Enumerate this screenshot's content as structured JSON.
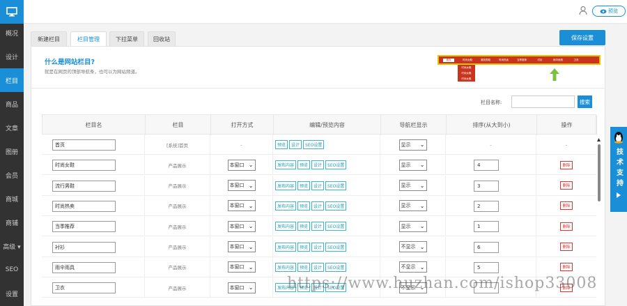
{
  "sidebar": {
    "items": [
      {
        "label": "概况"
      },
      {
        "label": "设计"
      },
      {
        "label": "栏目"
      },
      {
        "label": "商品"
      },
      {
        "label": "文章"
      },
      {
        "label": "图册"
      },
      {
        "label": "会员"
      },
      {
        "label": "商城"
      },
      {
        "label": "商铺"
      },
      {
        "label": "高级 ▾"
      },
      {
        "label": "SEO"
      },
      {
        "label": "设置"
      }
    ]
  },
  "header": {
    "preview_label": "预览"
  },
  "tabs": [
    "新建栏目",
    "栏目管理",
    "下拉菜单",
    "回收站"
  ],
  "toolbar": {
    "save_label": "保存设置"
  },
  "info": {
    "title": "什么是网站栏目?",
    "desc": "就是在网页的顶部导航条，也可以为网站频道。"
  },
  "nav_demo": {
    "items": [
      "首页",
      "时尚女鞋",
      "潮流男鞋",
      "时尚热卖",
      "当季推荐",
      "衬衫",
      "雨伞雨具",
      "卫衣"
    ],
    "submenu": [
      "时尚女鞋",
      "时尚女鞋",
      "时尚女鞋"
    ]
  },
  "filter": {
    "label": "栏目名称:",
    "button": "搜索"
  },
  "table": {
    "headers": [
      "栏目名",
      "栏目",
      "打开方式",
      "编辑/预览内容",
      "导航栏显示",
      "排序(从大到小)",
      "操作"
    ],
    "rows": [
      {
        "name": "首页",
        "type": "[系统]首页",
        "open": "-",
        "actions": [
          "预览",
          "设计",
          "SEO设置"
        ],
        "nav": "显示",
        "order": "-",
        "op": "-"
      },
      {
        "name": "时尚女鞋",
        "type": "产品展示",
        "open": "本窗口",
        "actions": [
          "发布内容",
          "预览",
          "设计",
          "SEO设置"
        ],
        "nav": "显示",
        "order": "4",
        "op": "删除"
      },
      {
        "name": "流行男鞋",
        "type": "产品展示",
        "open": "本窗口",
        "actions": [
          "发布内容",
          "预览",
          "设计",
          "SEO设置"
        ],
        "nav": "显示",
        "order": "3",
        "op": "删除"
      },
      {
        "name": "时尚热卖",
        "type": "产品展示",
        "open": "本窗口",
        "actions": [
          "发布内容",
          "预览",
          "设计",
          "SEO设置"
        ],
        "nav": "显示",
        "order": "2",
        "op": "删除"
      },
      {
        "name": "当季推荐",
        "type": "产品展示",
        "open": "本窗口",
        "actions": [
          "发布内容",
          "预览",
          "设计",
          "SEO设置"
        ],
        "nav": "显示",
        "order": "1",
        "op": "删除"
      },
      {
        "name": "衬衫",
        "type": "产品展示",
        "open": "本窗口",
        "actions": [
          "发布内容",
          "预览",
          "设计",
          "SEO设置"
        ],
        "nav": "不显示",
        "order": "6",
        "op": "删除"
      },
      {
        "name": "雨伞雨具",
        "type": "产品展示",
        "open": "本窗口",
        "actions": [
          "发布内容",
          "预览",
          "设计",
          "SEO设置"
        ],
        "nav": "不显示",
        "order": "5",
        "op": "删除"
      },
      {
        "name": "卫衣",
        "type": "产品展示",
        "open": "本窗口",
        "actions": [
          "发布内容",
          "预览",
          "设计",
          "SEO设置"
        ],
        "nav": "不显示",
        "order": "",
        "op": "删除"
      }
    ]
  },
  "support": {
    "label": "技术支持"
  },
  "watermark": "https://www.huzhan.com/ishop33008",
  "colors": {
    "accent": "#1a8fd8",
    "sidebar": "#323232",
    "danger": "#dd3333",
    "nav_demo": "#c8341d"
  }
}
